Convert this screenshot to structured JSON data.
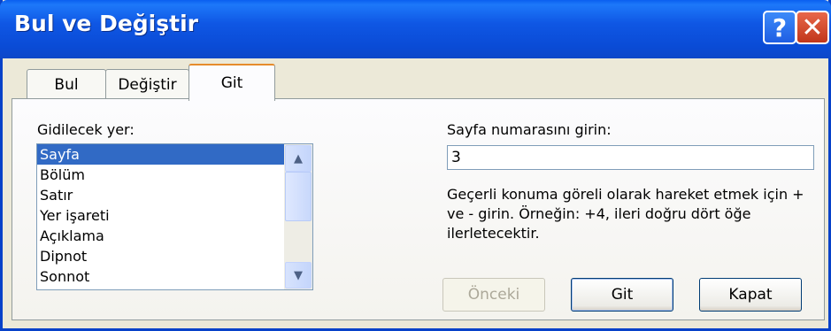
{
  "window": {
    "title": "Bul ve Değiştir"
  },
  "titlebar_buttons": {
    "help": "?",
    "close": "✕"
  },
  "tabs": [
    {
      "label": "Bul",
      "active": false
    },
    {
      "label": "Değiştir",
      "active": false
    },
    {
      "label": "Git",
      "active": true
    }
  ],
  "goto": {
    "label": "Gidilecek yer:",
    "items": [
      "Sayfa",
      "Bölüm",
      "Satır",
      "Yer işareti",
      "Açıklama",
      "Dipnot",
      "Sonnot"
    ],
    "selected": "Sayfa"
  },
  "page_input": {
    "label": "Sayfa numarasını girin:",
    "value": "3"
  },
  "help_text": "Geçerli konuma göreli olarak hareket etmek için + ve - girin. Örneğin: +4, ileri doğru dört öğe ilerletecektir.",
  "buttons": {
    "previous": "Önceki",
    "go": "Git",
    "close": "Kapat"
  },
  "icons": {
    "scroll_up": "▲",
    "scroll_down": "▼"
  },
  "colors": {
    "titlebar": "#0a4bd6",
    "selection": "#316ac5",
    "dialog_bg": "#ece9d8"
  }
}
